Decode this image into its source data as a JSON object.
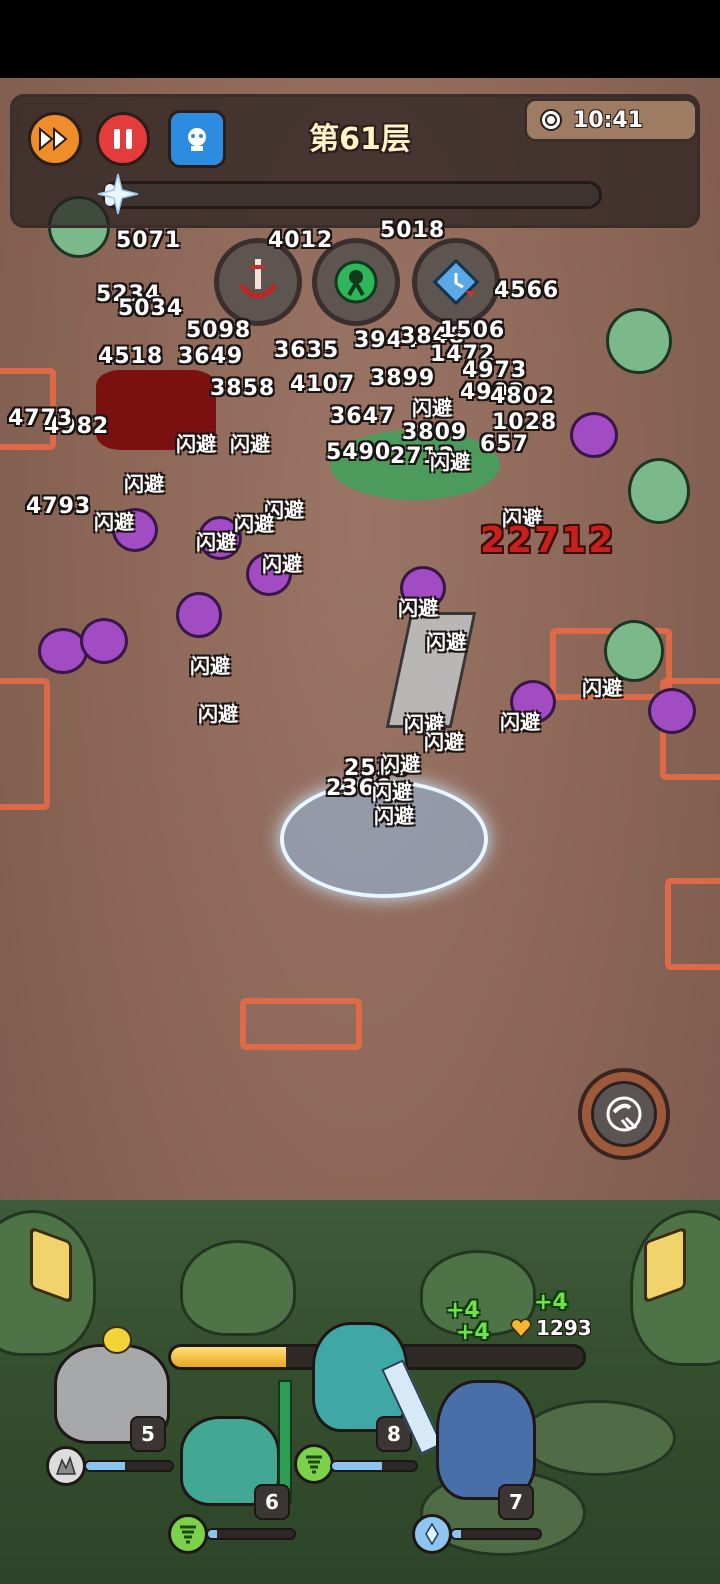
{
  "hud": {
    "floor_title": "第61层",
    "timer": "10:41",
    "wave_progress": 0.02,
    "icons": {
      "fast_forward": "fast-forward-icon",
      "pause": "pause-icon",
      "boss": "boss-card-icon",
      "clock": "clock-icon"
    }
  },
  "skills": [
    {
      "name": "sword-skill-icon"
    },
    {
      "name": "poison-skill-icon"
    },
    {
      "name": "time-slow-skill-icon"
    }
  ],
  "combat": {
    "damage_numbers": [
      "5071",
      "4012",
      "5018",
      "5234",
      "5034",
      "4566",
      "4518",
      "3649",
      "5098",
      "3635",
      "3944",
      "3848",
      "1506",
      "1472",
      "4973",
      "4902",
      "4802",
      "1028",
      "3647",
      "3809",
      "4982",
      "4773",
      "4793",
      "5490",
      "2530",
      "2366",
      "3858",
      "4107",
      "3899",
      "657",
      "2712"
    ],
    "critical": "22712",
    "dodge_label": "闪避"
  },
  "ultimate": {
    "icon": "ultimate-claw-icon"
  },
  "party": {
    "xp_progress": 0.28,
    "gains": [
      "+4",
      "+4",
      "+4"
    ],
    "gold": "1293",
    "heroes": [
      {
        "name": "stone-golem",
        "level": "5",
        "hp": 0.45
      },
      {
        "name": "druid-bird",
        "level": "6",
        "hp": 0.1
      },
      {
        "name": "ghost-mage",
        "level": "8",
        "hp": 0.6
      },
      {
        "name": "ice-knight",
        "level": "7",
        "hp": 0.1
      }
    ]
  }
}
